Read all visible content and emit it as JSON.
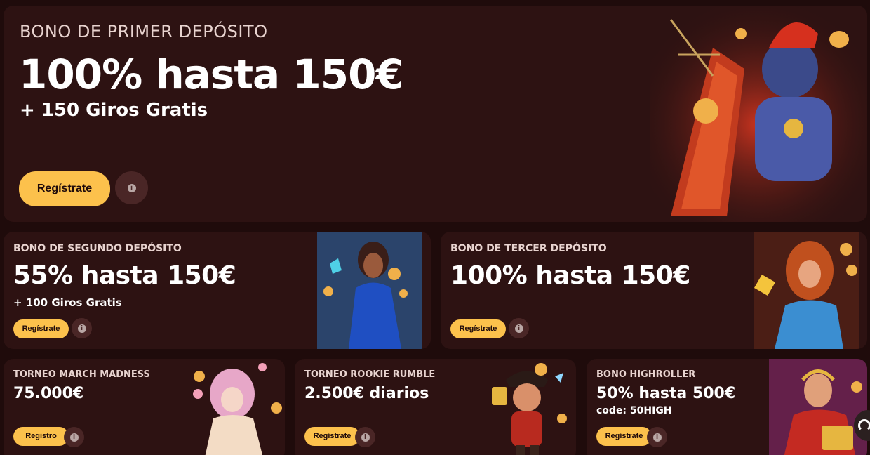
{
  "hero": {
    "eyebrow": "BONO DE PRIMER DEPÓSITO",
    "headline": "100% hasta 150€",
    "sub": "+ 150 Giros Gratis",
    "button": "Regístrate",
    "info_icon": "info-icon",
    "illustration": "gladiator-warrior-illustration"
  },
  "second": {
    "eyebrow": "BONO DE SEGUNDO DEPÓSITO",
    "headline": "55% hasta 150€",
    "sub": "+ 100 Giros Gratis",
    "button": "Regístrate",
    "illustration": "egyptian-queen-illustration"
  },
  "third": {
    "eyebrow": "BONO DE TERCER DEPÓSITO",
    "headline": "100% hasta 150€",
    "button": "Regístrate",
    "illustration": "greek-goddess-illustration"
  },
  "march": {
    "eyebrow": "TORNEO MARCH MADNESS",
    "headline": "75.000€",
    "button": "Registro",
    "illustration": "elf-girl-illustration"
  },
  "rookie": {
    "eyebrow": "TORNEO ROOKIE RUMBLE",
    "headline": "2.500€ diarios",
    "button": "Regístrate",
    "illustration": "pirate-illustration"
  },
  "highroller": {
    "eyebrow": "BONO HIGHROLLER",
    "headline": "50% hasta 500€",
    "sub": "code: 50HIGH",
    "button": "Regístrate",
    "illustration": "caesar-illustration"
  },
  "colors": {
    "background": "#1f0b0b",
    "card": "#2d1212",
    "accent": "#fcc14c"
  },
  "support": {
    "icon": "headset-icon"
  }
}
